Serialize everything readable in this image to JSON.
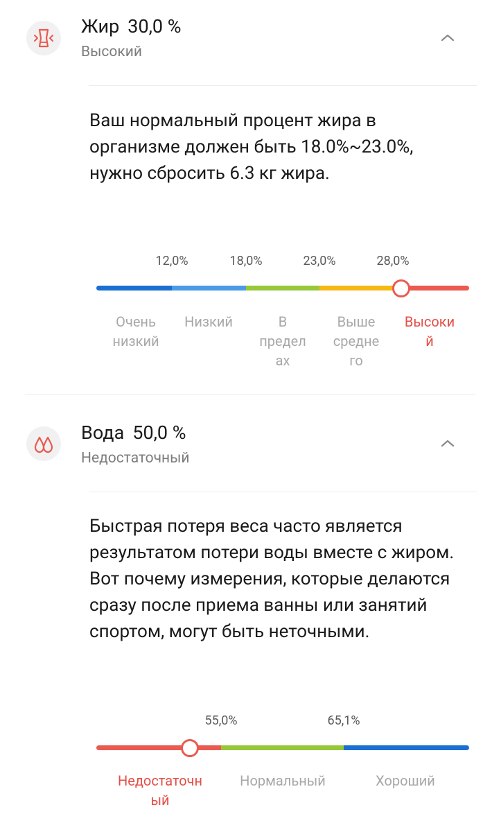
{
  "fat": {
    "icon": "body-waist-icon",
    "label": "Жир",
    "value": "30,0 %",
    "status": "Высокий",
    "description": "Ваш нормальный процент жира в организме должен быть 18.0%~23.0%, нужно сбросить 6.3 кг жира.",
    "scale": {
      "ticks": [
        "12,0%",
        "18,0%",
        "23,0%",
        "28,0%"
      ],
      "categories": [
        {
          "label": "Очень низкий",
          "line1": "Очень",
          "line2": "низкий",
          "color": "#1a6fd1"
        },
        {
          "label": "Низкий",
          "line1": "Низкий",
          "color": "#4a9ae6"
        },
        {
          "label": "В пределах",
          "line1": "В",
          "line2": "предел",
          "line3": "ах",
          "color": "#97c83a"
        },
        {
          "label": "Выше среднего",
          "line1": "Выше",
          "line2": "средне",
          "line3": "го",
          "color": "#f5b914"
        },
        {
          "label": "Высокий",
          "line1": "Высоки",
          "line2": "й",
          "color": "#ea5a50"
        }
      ],
      "current_category": "Высокий",
      "current_value": 30.0
    }
  },
  "water": {
    "icon": "water-drops-icon",
    "label": "Вода",
    "value": "50,0 %",
    "status": "Недостаточный",
    "description": "Быстрая потеря веса часто является результатом потери воды вместе с жиром. Вот почему измерения, которые делаются сразу после приема ванны или занятий спортом, могут быть неточными.",
    "scale": {
      "ticks": [
        "55,0%",
        "65,1%"
      ],
      "categories": [
        {
          "label": "Недостаточный",
          "line1": "Недостаточн",
          "line2": "ый",
          "color": "#ea5a50"
        },
        {
          "label": "Нормальный",
          "line1": "Нормальный",
          "color": "#97c83a"
        },
        {
          "label": "Хороший",
          "line1": "Хороший",
          "color": "#1a6fd1"
        }
      ],
      "current_category": "Недостаточный",
      "current_value": 50.0
    }
  },
  "colors": {
    "accent": "#ea5a50",
    "icon_bg": "#f1f1f1"
  }
}
